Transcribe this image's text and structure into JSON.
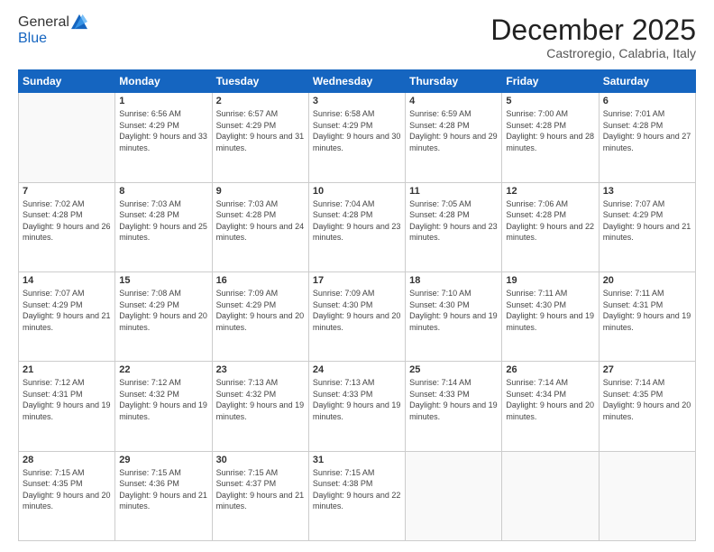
{
  "logo": {
    "general": "General",
    "blue": "Blue"
  },
  "title": "December 2025",
  "location": "Castroregio, Calabria, Italy",
  "headers": [
    "Sunday",
    "Monday",
    "Tuesday",
    "Wednesday",
    "Thursday",
    "Friday",
    "Saturday"
  ],
  "weeks": [
    [
      {
        "day": "",
        "sunrise": "",
        "sunset": "",
        "daylight": "",
        "empty": true
      },
      {
        "day": "1",
        "sunrise": "Sunrise: 6:56 AM",
        "sunset": "Sunset: 4:29 PM",
        "daylight": "Daylight: 9 hours and 33 minutes."
      },
      {
        "day": "2",
        "sunrise": "Sunrise: 6:57 AM",
        "sunset": "Sunset: 4:29 PM",
        "daylight": "Daylight: 9 hours and 31 minutes."
      },
      {
        "day": "3",
        "sunrise": "Sunrise: 6:58 AM",
        "sunset": "Sunset: 4:29 PM",
        "daylight": "Daylight: 9 hours and 30 minutes."
      },
      {
        "day": "4",
        "sunrise": "Sunrise: 6:59 AM",
        "sunset": "Sunset: 4:28 PM",
        "daylight": "Daylight: 9 hours and 29 minutes."
      },
      {
        "day": "5",
        "sunrise": "Sunrise: 7:00 AM",
        "sunset": "Sunset: 4:28 PM",
        "daylight": "Daylight: 9 hours and 28 minutes."
      },
      {
        "day": "6",
        "sunrise": "Sunrise: 7:01 AM",
        "sunset": "Sunset: 4:28 PM",
        "daylight": "Daylight: 9 hours and 27 minutes."
      }
    ],
    [
      {
        "day": "7",
        "sunrise": "Sunrise: 7:02 AM",
        "sunset": "Sunset: 4:28 PM",
        "daylight": "Daylight: 9 hours and 26 minutes."
      },
      {
        "day": "8",
        "sunrise": "Sunrise: 7:03 AM",
        "sunset": "Sunset: 4:28 PM",
        "daylight": "Daylight: 9 hours and 25 minutes."
      },
      {
        "day": "9",
        "sunrise": "Sunrise: 7:03 AM",
        "sunset": "Sunset: 4:28 PM",
        "daylight": "Daylight: 9 hours and 24 minutes."
      },
      {
        "day": "10",
        "sunrise": "Sunrise: 7:04 AM",
        "sunset": "Sunset: 4:28 PM",
        "daylight": "Daylight: 9 hours and 23 minutes."
      },
      {
        "day": "11",
        "sunrise": "Sunrise: 7:05 AM",
        "sunset": "Sunset: 4:28 PM",
        "daylight": "Daylight: 9 hours and 23 minutes."
      },
      {
        "day": "12",
        "sunrise": "Sunrise: 7:06 AM",
        "sunset": "Sunset: 4:28 PM",
        "daylight": "Daylight: 9 hours and 22 minutes."
      },
      {
        "day": "13",
        "sunrise": "Sunrise: 7:07 AM",
        "sunset": "Sunset: 4:29 PM",
        "daylight": "Daylight: 9 hours and 21 minutes."
      }
    ],
    [
      {
        "day": "14",
        "sunrise": "Sunrise: 7:07 AM",
        "sunset": "Sunset: 4:29 PM",
        "daylight": "Daylight: 9 hours and 21 minutes."
      },
      {
        "day": "15",
        "sunrise": "Sunrise: 7:08 AM",
        "sunset": "Sunset: 4:29 PM",
        "daylight": "Daylight: 9 hours and 20 minutes."
      },
      {
        "day": "16",
        "sunrise": "Sunrise: 7:09 AM",
        "sunset": "Sunset: 4:29 PM",
        "daylight": "Daylight: 9 hours and 20 minutes."
      },
      {
        "day": "17",
        "sunrise": "Sunrise: 7:09 AM",
        "sunset": "Sunset: 4:30 PM",
        "daylight": "Daylight: 9 hours and 20 minutes."
      },
      {
        "day": "18",
        "sunrise": "Sunrise: 7:10 AM",
        "sunset": "Sunset: 4:30 PM",
        "daylight": "Daylight: 9 hours and 19 minutes."
      },
      {
        "day": "19",
        "sunrise": "Sunrise: 7:11 AM",
        "sunset": "Sunset: 4:30 PM",
        "daylight": "Daylight: 9 hours and 19 minutes."
      },
      {
        "day": "20",
        "sunrise": "Sunrise: 7:11 AM",
        "sunset": "Sunset: 4:31 PM",
        "daylight": "Daylight: 9 hours and 19 minutes."
      }
    ],
    [
      {
        "day": "21",
        "sunrise": "Sunrise: 7:12 AM",
        "sunset": "Sunset: 4:31 PM",
        "daylight": "Daylight: 9 hours and 19 minutes."
      },
      {
        "day": "22",
        "sunrise": "Sunrise: 7:12 AM",
        "sunset": "Sunset: 4:32 PM",
        "daylight": "Daylight: 9 hours and 19 minutes."
      },
      {
        "day": "23",
        "sunrise": "Sunrise: 7:13 AM",
        "sunset": "Sunset: 4:32 PM",
        "daylight": "Daylight: 9 hours and 19 minutes."
      },
      {
        "day": "24",
        "sunrise": "Sunrise: 7:13 AM",
        "sunset": "Sunset: 4:33 PM",
        "daylight": "Daylight: 9 hours and 19 minutes."
      },
      {
        "day": "25",
        "sunrise": "Sunrise: 7:14 AM",
        "sunset": "Sunset: 4:33 PM",
        "daylight": "Daylight: 9 hours and 19 minutes."
      },
      {
        "day": "26",
        "sunrise": "Sunrise: 7:14 AM",
        "sunset": "Sunset: 4:34 PM",
        "daylight": "Daylight: 9 hours and 20 minutes."
      },
      {
        "day": "27",
        "sunrise": "Sunrise: 7:14 AM",
        "sunset": "Sunset: 4:35 PM",
        "daylight": "Daylight: 9 hours and 20 minutes."
      }
    ],
    [
      {
        "day": "28",
        "sunrise": "Sunrise: 7:15 AM",
        "sunset": "Sunset: 4:35 PM",
        "daylight": "Daylight: 9 hours and 20 minutes."
      },
      {
        "day": "29",
        "sunrise": "Sunrise: 7:15 AM",
        "sunset": "Sunset: 4:36 PM",
        "daylight": "Daylight: 9 hours and 21 minutes."
      },
      {
        "day": "30",
        "sunrise": "Sunrise: 7:15 AM",
        "sunset": "Sunset: 4:37 PM",
        "daylight": "Daylight: 9 hours and 21 minutes."
      },
      {
        "day": "31",
        "sunrise": "Sunrise: 7:15 AM",
        "sunset": "Sunset: 4:38 PM",
        "daylight": "Daylight: 9 hours and 22 minutes."
      },
      {
        "day": "",
        "sunrise": "",
        "sunset": "",
        "daylight": "",
        "empty": true
      },
      {
        "day": "",
        "sunrise": "",
        "sunset": "",
        "daylight": "",
        "empty": true
      },
      {
        "day": "",
        "sunrise": "",
        "sunset": "",
        "daylight": "",
        "empty": true
      }
    ]
  ]
}
